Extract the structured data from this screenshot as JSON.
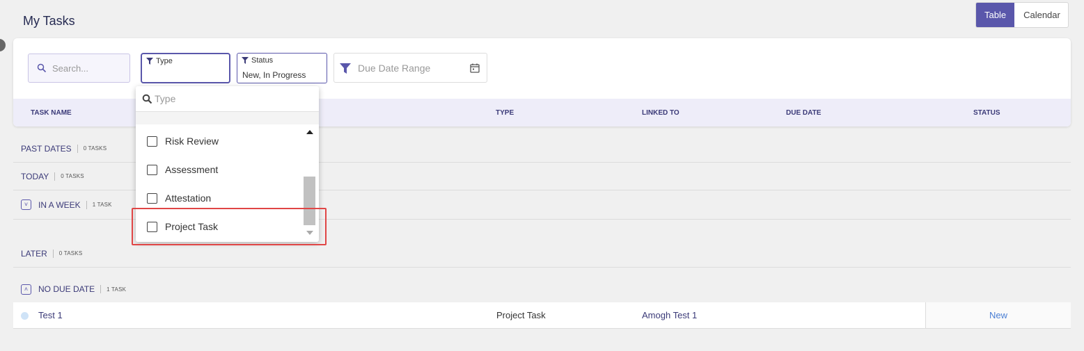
{
  "page": {
    "title": "My Tasks"
  },
  "view_toggle": {
    "table_label": "Table",
    "calendar_label": "Calendar"
  },
  "filters": {
    "search_placeholder": "Search...",
    "type_label": "Type",
    "status_label": "Status",
    "status_value": "New, In Progress",
    "due_date_placeholder": "Due Date Range"
  },
  "table": {
    "columns": [
      "TASK NAME",
      "TYPE",
      "LINKED TO",
      "DUE DATE",
      "STATUS"
    ]
  },
  "groups": [
    {
      "label": "PAST DATES",
      "count": "0 TASKS",
      "collapsible": false
    },
    {
      "label": "TODAY",
      "count": "0 TASKS",
      "collapsible": false
    },
    {
      "label": "IN A WEEK",
      "count": "1 TASK",
      "collapsible": true,
      "chevron": "˅"
    },
    {
      "label": "LATER",
      "count": "0 TASKS",
      "collapsible": false
    },
    {
      "label": "NO DUE DATE",
      "count": "1 TASK",
      "collapsible": true,
      "chevron": "˄"
    }
  ],
  "task": {
    "name": "Test 1",
    "type": "Project Task",
    "linked_to": "Amogh Test 1",
    "status": "New"
  },
  "type_dropdown": {
    "search_placeholder": "Type",
    "options": [
      "Risk Review",
      "Assessment",
      "Attestation",
      "Project Task"
    ]
  },
  "colors": {
    "accent": "#5a57ab",
    "header_bg": "#eeedf9",
    "highlight": "#e04646",
    "status_new": "#4a7fd4"
  }
}
